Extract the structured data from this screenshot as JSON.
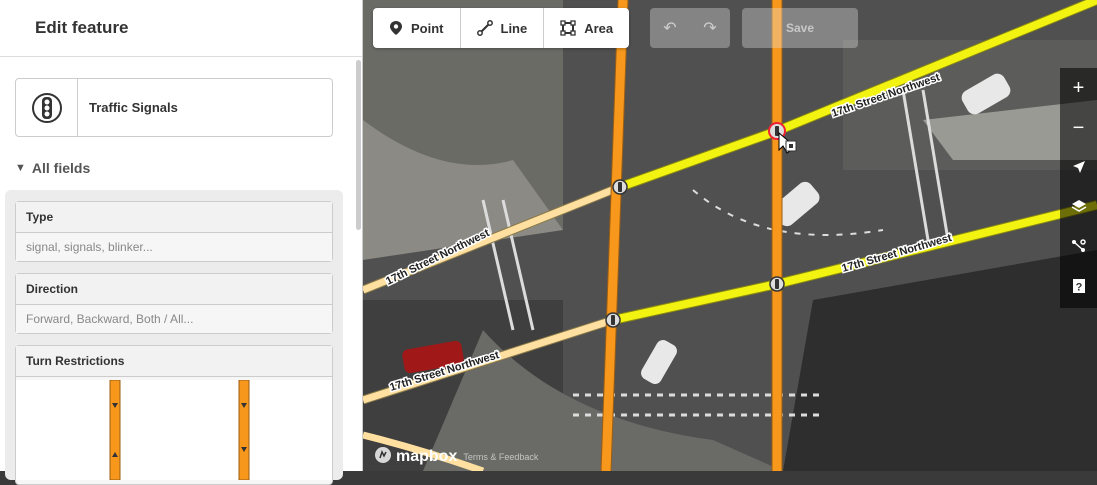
{
  "sidebar": {
    "title": "Edit feature",
    "preset": {
      "label": "Traffic Signals",
      "icon": "traffic-signals-icon"
    },
    "all_fields_label": "All fields",
    "fields": [
      {
        "label": "Type",
        "placeholder": "signal, signals, blinker..."
      },
      {
        "label": "Direction",
        "placeholder": "Forward, Backward, Both / All..."
      },
      {
        "label": "Turn Restrictions"
      }
    ]
  },
  "toolbar": {
    "point_label": "Point",
    "line_label": "Line",
    "area_label": "Area",
    "save_label": "Save"
  },
  "map": {
    "street_labels": [
      "17th Street Northwest",
      "17th Street Northwest",
      "17th Street Northwest",
      "17th Street Northwest"
    ],
    "attribution": {
      "logo": "mapbox",
      "terms": "Terms & Feedback"
    },
    "controls": [
      "zoom-in-icon",
      "zoom-out-icon",
      "geolocate-icon",
      "layers-icon",
      "map-data-icon",
      "help-icon"
    ],
    "colors": {
      "primary_road": "#f7981d",
      "secondary_road": "#f3f312",
      "tertiary_road": "#ffe0a0"
    }
  }
}
